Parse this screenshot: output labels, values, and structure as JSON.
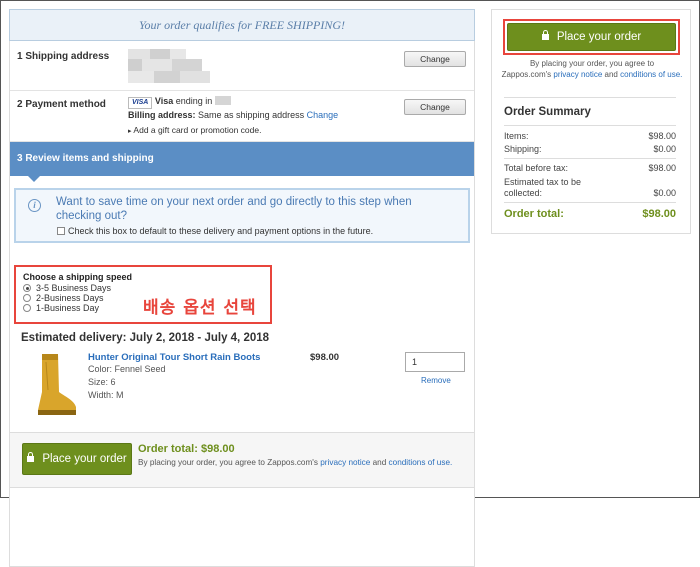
{
  "banner": {
    "text": "Your order qualifies for FREE SHIPPING!"
  },
  "shipping": {
    "step_label": "1  Shipping address",
    "change_label": "Change"
  },
  "payment": {
    "step_label": "2  Payment method",
    "card_brand": "VISA",
    "card_text": "Visa",
    "ending_text": "ending in",
    "billing_label": "Billing address:",
    "billing_value": "Same as shipping address",
    "billing_change": "Change",
    "gift_text": "Add a gift card or promotion code.",
    "change_label": "Change"
  },
  "review": {
    "step_label": "3  Review items and shipping",
    "info_text": "Want to save time on your next order and go directly to this step when checking out?",
    "checkbox_text": "Check this box to default to these delivery and payment options in the future."
  },
  "shipping_speed": {
    "title": "Choose a shipping speed",
    "options": [
      "3-5 Business Days",
      "2-Business Days",
      "1-Business Day"
    ],
    "selected_index": 0,
    "annotation": "배송 옵션 선택"
  },
  "delivery": {
    "estimate": "Estimated delivery:  July 2, 2018 - July 4, 2018"
  },
  "product": {
    "name": "Hunter Original Tour Short Rain Boots",
    "color": "Color: Fennel Seed",
    "size": "Size: 6",
    "width": "Width: M",
    "price": "$98.00",
    "quantity": "1",
    "remove_label": "Remove"
  },
  "bottom": {
    "place_label": "Place your order",
    "total_label": "Order total:",
    "total_value": "$98.00",
    "agree_prefix": "By placing your order, you agree to Zappos.com's",
    "privacy_link": "privacy notice",
    "and_text": "and",
    "conditions_link": "conditions of use."
  },
  "sidebar": {
    "place_label": "Place your order",
    "agree_line1": "By placing your order, you agree to",
    "agree_prefix": "Zappos.com's",
    "privacy_link": "privacy notice",
    "and_text": "and",
    "conditions_link": "conditions of use.",
    "summary_title": "Order Summary",
    "items_label": "Items:",
    "items_value": "$98.00",
    "shipping_label": "Shipping:",
    "shipping_value": "$0.00",
    "before_tax_label": "Total before tax:",
    "before_tax_value": "$98.00",
    "tax_label": "Estimated tax to be collected:",
    "tax_value": "$0.00",
    "total_label": "Order total:",
    "total_value": "$98.00"
  },
  "colors": {
    "accent_green": "#6e8f1d",
    "review_blue": "#5b8ec5",
    "highlight_red": "#e8453c",
    "link_blue": "#2a6ebb"
  }
}
